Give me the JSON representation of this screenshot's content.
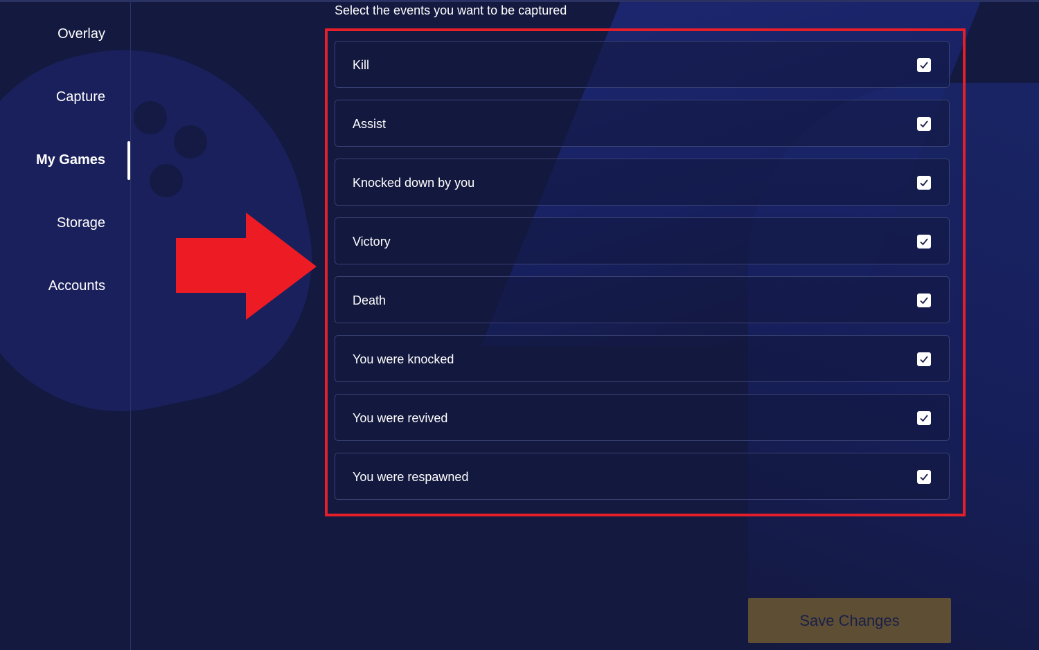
{
  "sidebar": {
    "items": [
      {
        "label": "Overlay",
        "active": false
      },
      {
        "label": "Capture",
        "active": false
      },
      {
        "label": "My Games",
        "active": true
      },
      {
        "label": "Storage",
        "active": false
      },
      {
        "label": "Accounts",
        "active": false
      }
    ]
  },
  "main": {
    "heading": "Select the events you want to be captured",
    "events": [
      {
        "label": "Kill",
        "checked": true
      },
      {
        "label": "Assist",
        "checked": true
      },
      {
        "label": "Knocked down by you",
        "checked": true
      },
      {
        "label": "Victory",
        "checked": true
      },
      {
        "label": "Death",
        "checked": true
      },
      {
        "label": "You were knocked",
        "checked": true
      },
      {
        "label": "You were revived",
        "checked": true
      },
      {
        "label": "You were respawned",
        "checked": true
      }
    ],
    "save_label": "Save Changes"
  },
  "colors": {
    "background": "#14193f",
    "highlight": "#e51f2a",
    "save_button": "#5e4f34"
  },
  "icons": {
    "check": "check-icon",
    "arrow": "arrow-right-icon"
  }
}
